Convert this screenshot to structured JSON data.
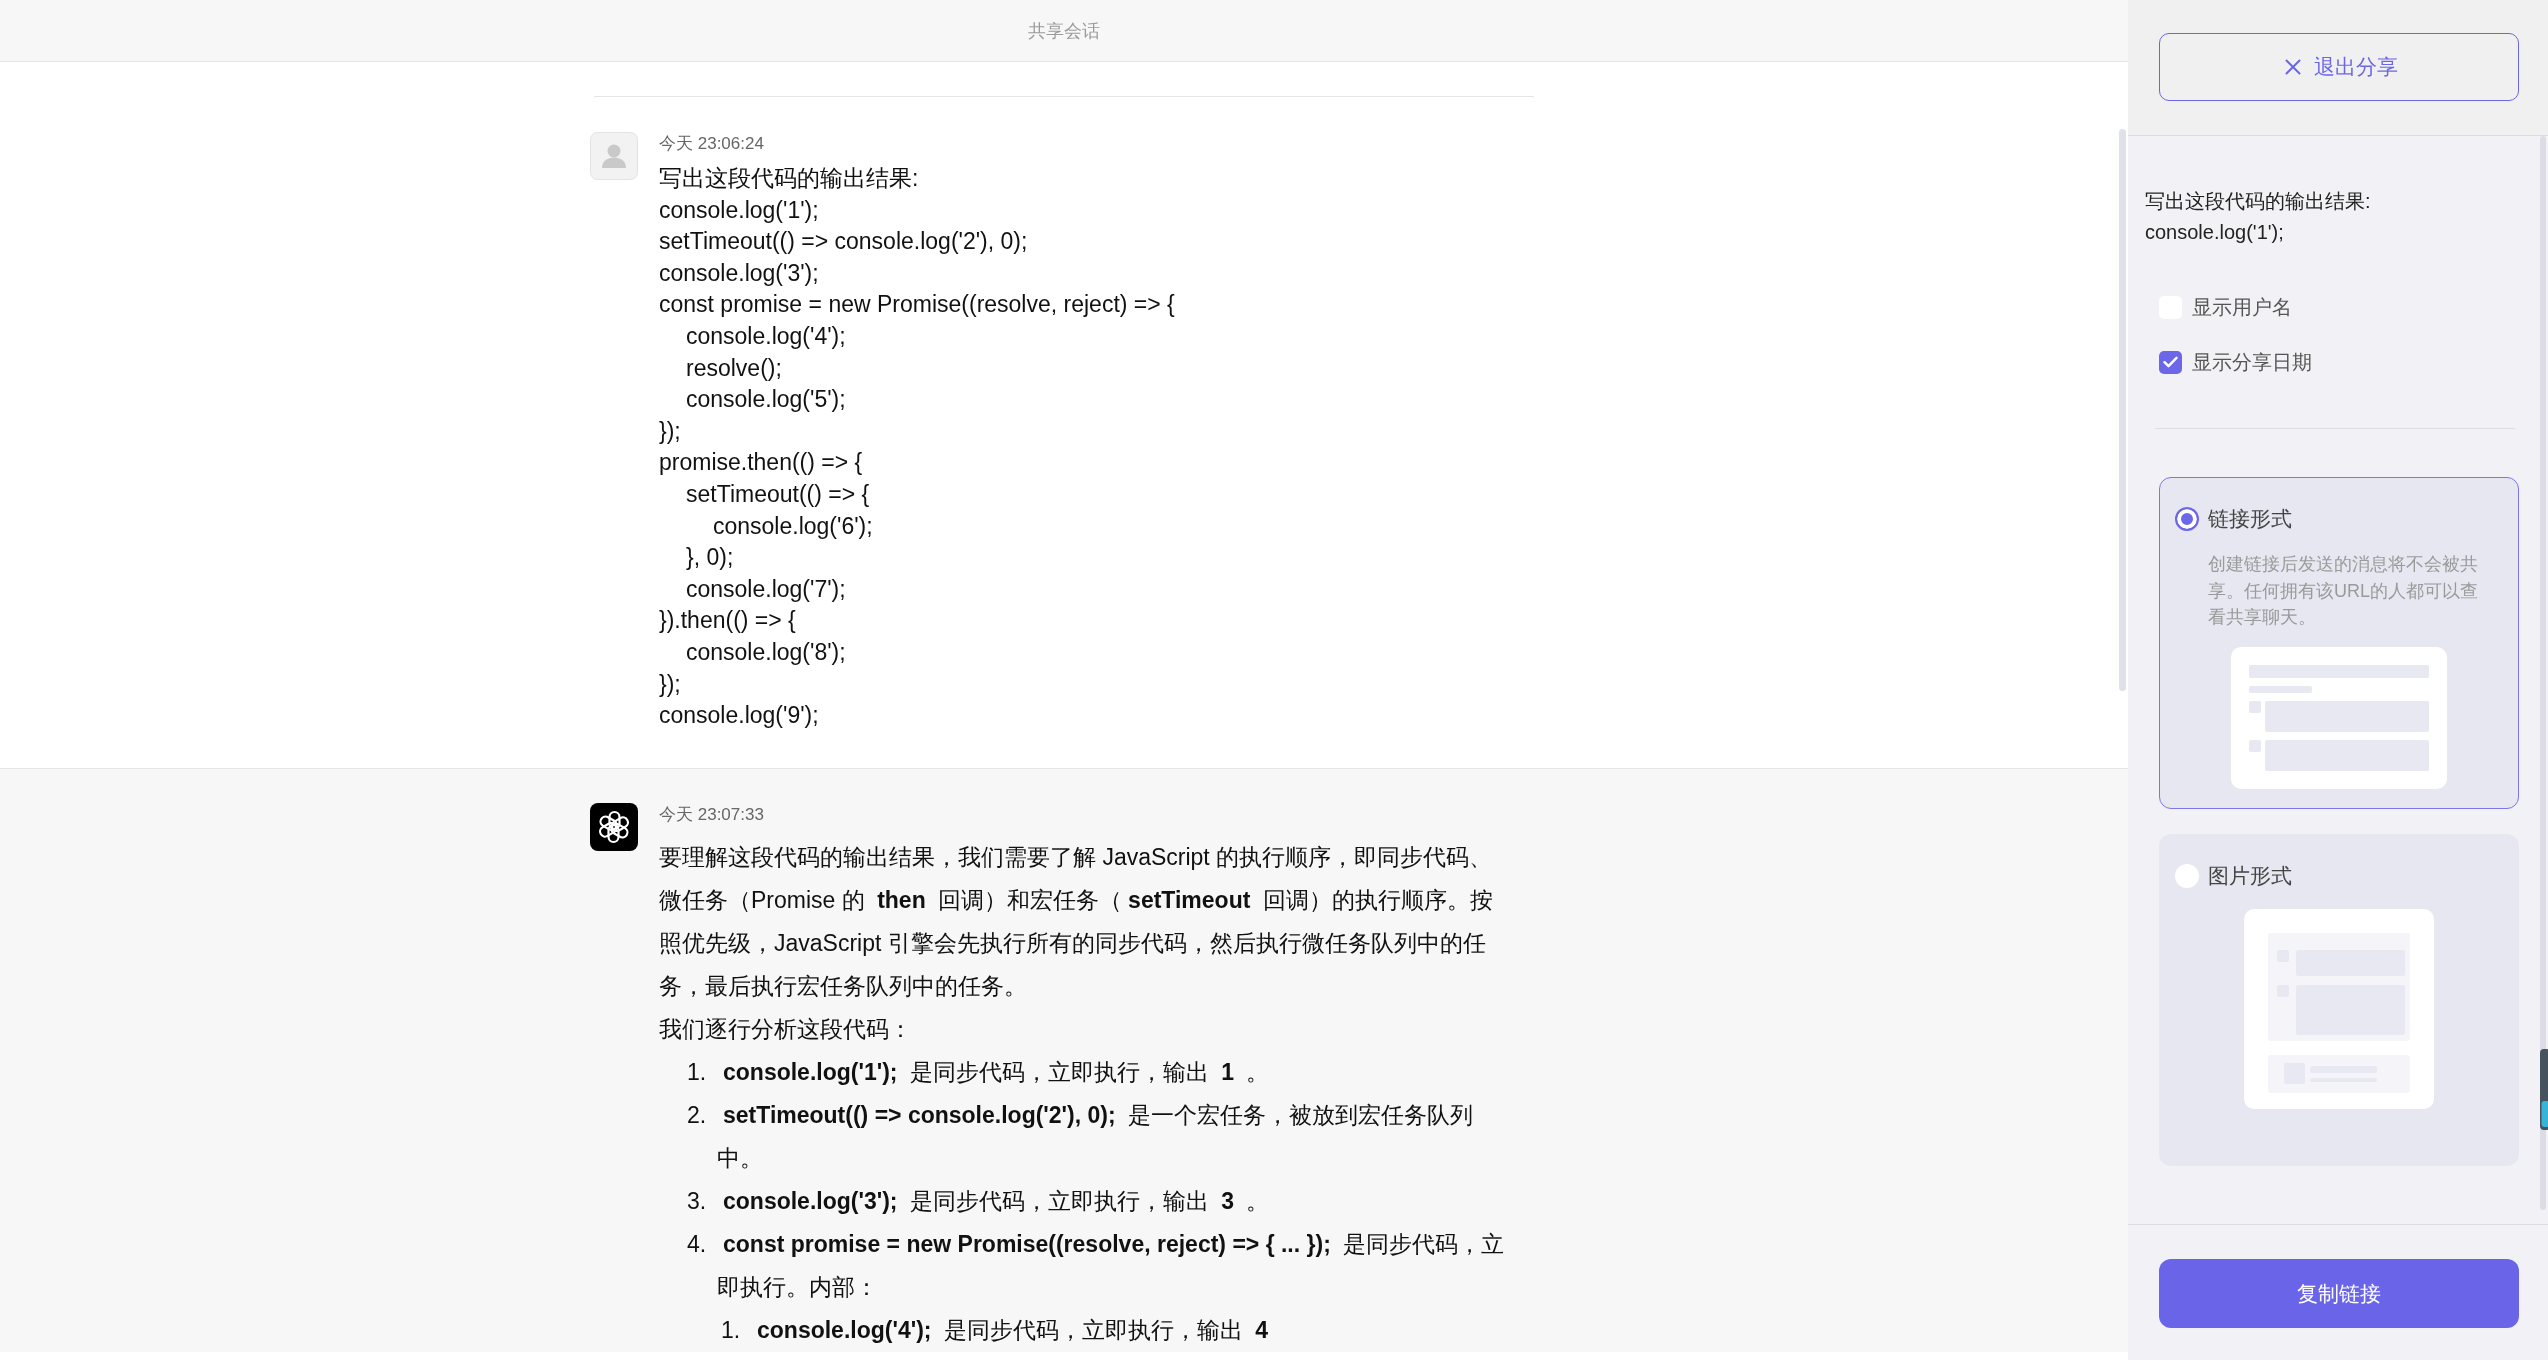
{
  "header": {
    "title": "共享会话"
  },
  "messages": [
    {
      "kind": "user",
      "time": "今天 23:06:24",
      "lines": [
        {
          "text": "写出这段代码的输出结果:"
        },
        {
          "text": "console.log('1');"
        },
        {
          "text": "setTimeout(() => console.log('2'), 0);"
        },
        {
          "text": "console.log('3');"
        },
        {
          "text": "const promise = new Promise((resolve, reject) => {",
          "children": [
            {
              "text": "console.log('4');"
            },
            {
              "text": "resolve();"
            },
            {
              "text": "console.log('5');"
            }
          ]
        },
        {
          "text": "});"
        },
        {
          "text": "promise.then(() => {",
          "children": [
            {
              "text": "setTimeout(() => {",
              "children": [
                {
                  "text": "console.log('6');"
                }
              ]
            },
            {
              "text": "}, 0);"
            },
            {
              "text": "console.log('7');"
            }
          ]
        },
        {
          "text": "}).then(() => {",
          "children": [
            {
              "text": "console.log('8');"
            }
          ]
        },
        {
          "text": "});"
        },
        {
          "text": "console.log('9');"
        }
      ]
    },
    {
      "kind": "assistant",
      "time": "今天 23:07:33",
      "paragraphs": [
        "要理解这段代码的输出结果，我们需要了解 JavaScript 的执行顺序，即同步代码、微任务（Promise 的 **then** 回调）和宏任务（**setTimeout** 回调）的执行顺序。按照优先级，JavaScript 引擎会先执行所有的同步代码，然后执行微任务队列中的任务，最后执行宏任务队列中的任务。",
        "我们逐行分析这段代码："
      ],
      "steps": [
        {
          "number": "1.",
          "text": "**console.log('1');** 是同步代码，立即执行，输出 **1** 。"
        },
        {
          "number": "2.",
          "text": "**setTimeout(() => console.log('2'), 0);** 是一个宏任务，被放到宏任务队列中。"
        },
        {
          "number": "3.",
          "text": "**console.log('3');** 是同步代码，立即执行，输出 **3** 。"
        },
        {
          "number": "4.",
          "text": "**const promise = new Promise((resolve, reject) => { ... });** 是同步代码，立即执行。内部：",
          "children": [
            {
              "number": "1.",
              "text": "**console.log('4');** 是同步代码，立即执行，输出 **4**"
            }
          ]
        }
      ]
    }
  ],
  "share_panel": {
    "exit_button": "退出分享",
    "preview_lines": [
      "写出这段代码的输出结果:",
      "console.log('1');"
    ],
    "options": [
      {
        "label": "显示用户名",
        "checked": false
      },
      {
        "label": "显示分享日期",
        "checked": true
      }
    ],
    "formats": [
      {
        "kind": "link",
        "label": "链接形式",
        "selected": true,
        "description": "创建链接后发送的消息将不会被共享。任何拥有该URL的人都可以查看共享聊天。"
      },
      {
        "kind": "image",
        "label": "图片形式",
        "selected": false
      }
    ],
    "copy_button": "复制链接"
  }
}
